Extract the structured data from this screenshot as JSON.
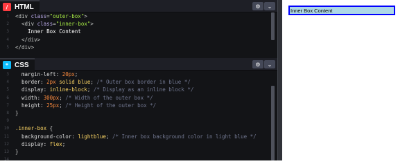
{
  "html_panel": {
    "title": "HTML",
    "icon": "html-icon",
    "lines": [
      {
        "n": "1",
        "t": [
          [
            "tag",
            "<div "
          ],
          [
            "attr",
            "class"
          ],
          [
            "tag",
            "="
          ],
          [
            "str",
            "\"outer-box\""
          ],
          [
            "tag",
            ">"
          ]
        ]
      },
      {
        "n": "2",
        "t": [
          [
            "txt",
            "  "
          ],
          [
            "tag",
            "<div "
          ],
          [
            "attr",
            "class"
          ],
          [
            "tag",
            "="
          ],
          [
            "str",
            "\"inner-box\""
          ],
          [
            "tag",
            ">"
          ]
        ]
      },
      {
        "n": "3",
        "t": [
          [
            "txt",
            "    Inner Box Content"
          ]
        ]
      },
      {
        "n": "4",
        "t": [
          [
            "txt",
            "  "
          ],
          [
            "tag",
            "</div>"
          ]
        ]
      },
      {
        "n": "5",
        "t": [
          [
            "tag",
            "</div>"
          ]
        ]
      }
    ]
  },
  "css_panel": {
    "title": "CSS",
    "icon": "css-icon",
    "lines": [
      {
        "n": "3",
        "t": [
          [
            "prop",
            "  margin-left: "
          ],
          [
            "num",
            "20px"
          ],
          [
            "punc",
            ";"
          ]
        ]
      },
      {
        "n": "4",
        "t": [
          [
            "prop",
            "  border: "
          ],
          [
            "num",
            "2px"
          ],
          [
            "val",
            " solid blue"
          ],
          [
            "punc",
            "; "
          ],
          [
            "cmt",
            "/* Outer box border in blue */"
          ]
        ]
      },
      {
        "n": "5",
        "t": [
          [
            "prop",
            "  display: "
          ],
          [
            "val",
            "inline-block"
          ],
          [
            "punc",
            "; "
          ],
          [
            "cmt",
            "/* Display as an inline block */"
          ]
        ]
      },
      {
        "n": "6",
        "t": [
          [
            "prop",
            "  width: "
          ],
          [
            "num",
            "300px"
          ],
          [
            "punc",
            "; "
          ],
          [
            "cmt",
            "/* Width of the outer box */"
          ]
        ]
      },
      {
        "n": "7",
        "t": [
          [
            "prop",
            "  height: "
          ],
          [
            "num",
            "25px"
          ],
          [
            "punc",
            "; "
          ],
          [
            "cmt",
            "/* Height of the outer box */"
          ]
        ]
      },
      {
        "n": "8",
        "t": [
          [
            "punc",
            "}"
          ]
        ]
      },
      {
        "n": "9",
        "t": []
      },
      {
        "n": "10",
        "t": [
          [
            "sel",
            ".inner-box"
          ],
          [
            "punc",
            " {"
          ]
        ]
      },
      {
        "n": "11",
        "t": [
          [
            "prop",
            "  background-color: "
          ],
          [
            "val",
            "lightblue"
          ],
          [
            "punc",
            "; "
          ],
          [
            "cmt",
            "/* Inner box background color in light blue */"
          ]
        ]
      },
      {
        "n": "12",
        "t": [
          [
            "prop",
            "  display: "
          ],
          [
            "val",
            "flex"
          ],
          [
            "punc",
            ";"
          ]
        ]
      },
      {
        "n": "13",
        "t": [
          [
            "punc",
            "}"
          ]
        ]
      },
      {
        "n": "14",
        "t": []
      }
    ]
  },
  "header_buttons": {
    "settings": "⚙",
    "collapse": "⌄"
  },
  "preview": {
    "inner_box_text": "Inner Box Content"
  },
  "colors": {
    "html_accent": "#ff3c41",
    "css_accent": "#0ebeff",
    "outer_border": "#0000ff",
    "inner_bg": "#add8e6"
  }
}
